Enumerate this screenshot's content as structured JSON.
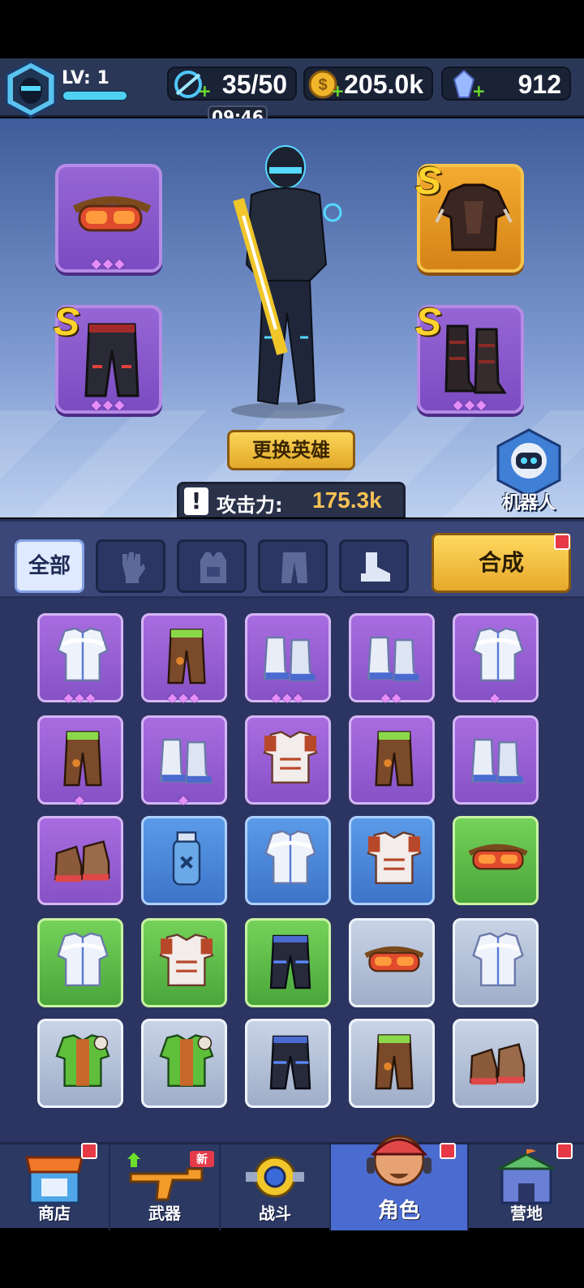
{
  "header": {
    "level_label": "LV: 1",
    "energy": "35/50",
    "energy_timer": "09:46",
    "coins": "205.0k",
    "gems": "912"
  },
  "hero_panel": {
    "change_hero_label": "更换英雄",
    "robot_label": "机器人",
    "power_label": "攻击力:",
    "power_value": "175.3k",
    "slots": [
      {
        "item": "goggles",
        "rank": "",
        "stars": "◆◆◆",
        "rarity": "purple"
      },
      {
        "item": "armor",
        "rank": "S",
        "stars": "",
        "rarity": "gold"
      },
      {
        "item": "pants",
        "rank": "S",
        "stars": "◆◆◆",
        "rarity": "purple"
      },
      {
        "item": "boots",
        "rank": "S",
        "stars": "◆◆◆",
        "rarity": "purple"
      }
    ]
  },
  "filters": {
    "all_label": "全部",
    "tabs": [
      "gloves-icon",
      "vest-icon",
      "pants-icon",
      "boot-icon"
    ],
    "synth_label": "合成"
  },
  "inventory": [
    {
      "item": "jacket",
      "rarity": "purple",
      "stars": "◆◆◆"
    },
    {
      "item": "leg-armor",
      "rarity": "purple",
      "stars": "◆◆◆"
    },
    {
      "item": "snow-boots",
      "rarity": "purple",
      "stars": "◆◆◆"
    },
    {
      "item": "snow-boots",
      "rarity": "purple",
      "stars": "◆◆"
    },
    {
      "item": "jacket",
      "rarity": "purple",
      "stars": "◆"
    },
    {
      "item": "leg-armor",
      "rarity": "purple",
      "stars": "◆"
    },
    {
      "item": "snow-boots",
      "rarity": "purple",
      "stars": "◆"
    },
    {
      "item": "vest",
      "rarity": "purple",
      "stars": ""
    },
    {
      "item": "leg-armor",
      "rarity": "purple",
      "stars": ""
    },
    {
      "item": "snow-boots",
      "rarity": "purple",
      "stars": ""
    },
    {
      "item": "sneakers",
      "rarity": "purple",
      "stars": ""
    },
    {
      "item": "canister",
      "rarity": "blue",
      "stars": ""
    },
    {
      "item": "jacket",
      "rarity": "blue",
      "stars": ""
    },
    {
      "item": "vest",
      "rarity": "blue",
      "stars": ""
    },
    {
      "item": "goggles",
      "rarity": "green",
      "stars": ""
    },
    {
      "item": "jacket",
      "rarity": "green",
      "stars": ""
    },
    {
      "item": "vest",
      "rarity": "green",
      "stars": ""
    },
    {
      "item": "pants",
      "rarity": "green",
      "stars": ""
    },
    {
      "item": "goggles",
      "rarity": "grey",
      "stars": ""
    },
    {
      "item": "jacket",
      "rarity": "grey",
      "stars": ""
    },
    {
      "item": "green-jacket",
      "rarity": "grey",
      "stars": ""
    },
    {
      "item": "green-jacket",
      "rarity": "grey",
      "stars": ""
    },
    {
      "item": "pants",
      "rarity": "grey",
      "stars": ""
    },
    {
      "item": "leg-armor",
      "rarity": "grey",
      "stars": ""
    },
    {
      "item": "sneakers",
      "rarity": "grey",
      "stars": ""
    }
  ],
  "nav": {
    "shop": "商店",
    "weapons": "武器",
    "weapons_badge": "新",
    "battle": "战斗",
    "character": "角色",
    "camp": "营地"
  },
  "colors": {
    "accent_gold": "#f8c253",
    "rarity_purple": "#8652c6",
    "rarity_blue": "#3e74c9",
    "rarity_green": "#4aa63a",
    "rarity_grey": "#9faec9"
  }
}
